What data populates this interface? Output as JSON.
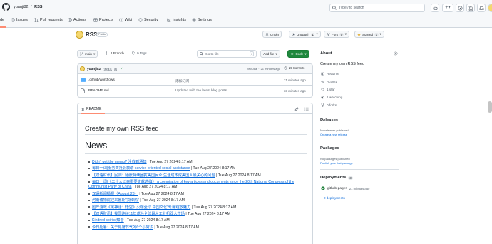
{
  "header": {
    "owner": "yuanji82",
    "separator": "/",
    "repo": "RSS",
    "search_placeholder": "Type / to search"
  },
  "nav": {
    "code_partial": "de",
    "issues": "Issues",
    "pulls": "Pull requests",
    "actions": "Actions",
    "projects": "Projects",
    "wiki": "Wiki",
    "security": "Security",
    "insights": "Insights",
    "settings": "Settings"
  },
  "repo": {
    "name": "RSS",
    "visibility": "Public",
    "unpin": "Unpin",
    "unwatch": "Unwatch",
    "watch_count": "1",
    "fork": "Fork",
    "fork_count": "0",
    "starred": "Starred",
    "star_count": "1"
  },
  "toolbar": {
    "branch": "main",
    "branches": "1 Branch",
    "tags": "0 Tags",
    "goto_file": "Go to file",
    "goto_key": "t",
    "add_file": "Add file",
    "code": "Code"
  },
  "commit": {
    "author": "yuanji82",
    "message": "添加订阅",
    "hash": "2ecf0aa",
    "sep": "·",
    "time": "21 minutes ago",
    "commits": "15 Commits"
  },
  "files": [
    {
      "name": ".github/workflows",
      "msg": "添加订阅",
      "time": "21 minutes ago"
    },
    {
      "name": "README.md",
      "msg": "Updated with the latest blog posts",
      "time": "33 minutes ago"
    }
  ],
  "readme": {
    "tab": "README",
    "h1": "Create my own RSS feed",
    "h2": "News"
  },
  "news": [
    {
      "link": "Didn't get the memo? 没收到通知",
      "date": " | Tue Aug 27 2024 8:17 AM"
    },
    {
      "link": "每日一词|服务类社会救助 service-oriented social assistance",
      "date": " | Tue Aug 27 2024 8:17 AM"
    },
    {
      "link": "【双语财讯】民调：通胀持续困扰美国民众 生活成本成美国人最关心的问题",
      "date": " | Tue Aug 27 2024 8:17 AM"
    },
    {
      "link": "每日一词|《二十大以来重要文献选编》 a compilation of key articles and documents since the 20th National Congress of the Communist Party of China",
      "date": " | Tue Aug 27 2024 8:17 AM"
    },
    {
      "link": "双语新闻播报（August 23）",
      "date": " | Tue Aug 27 2024 8:17 AM"
    },
    {
      "link": "河南博物院迎来暑期\"文博热\"",
      "date": " | Tue Aug 27 2024 8:17 AM"
    },
    {
      "link": "国产游戏《黑神话：悟空》火爆全球 中国文化'出海'绽放魅力",
      "date": " | Tue Aug 27 2024 8:17 AM"
    },
    {
      "link": "【双语财讯】我国连续11年成为全球最大工业机器人市场",
      "date": " | Tue Aug 27 2024 8:17 AM"
    },
    {
      "link": "Kindred spirits 知音",
      "date": " | Tue Aug 27 2024 8:17 AM"
    },
    {
      "link": "今日处暑：关于处暑节气的6个小常识",
      "date": " | Tue Aug 27 2024 8:17 AM"
    }
  ],
  "about": {
    "title": "About",
    "desc": "Create my own RSS feed",
    "readme": "Readme",
    "activity": "Activity",
    "stars": "1 star",
    "watching": "1 watching",
    "forks": "0 forks"
  },
  "releases": {
    "title": "Releases",
    "none": "No releases published",
    "create": "Create a new release"
  },
  "packages": {
    "title": "Packages",
    "none": "No packages published",
    "publish": "Publish your first package"
  },
  "deployments": {
    "title": "Deployments",
    "count": "3",
    "env": "github-pages",
    "time": "21 minutes ago",
    "more": "+ 2 deployments"
  },
  "colors": {
    "accent": "#0969da",
    "green": "#1f883d",
    "border": "#d0d7de"
  }
}
